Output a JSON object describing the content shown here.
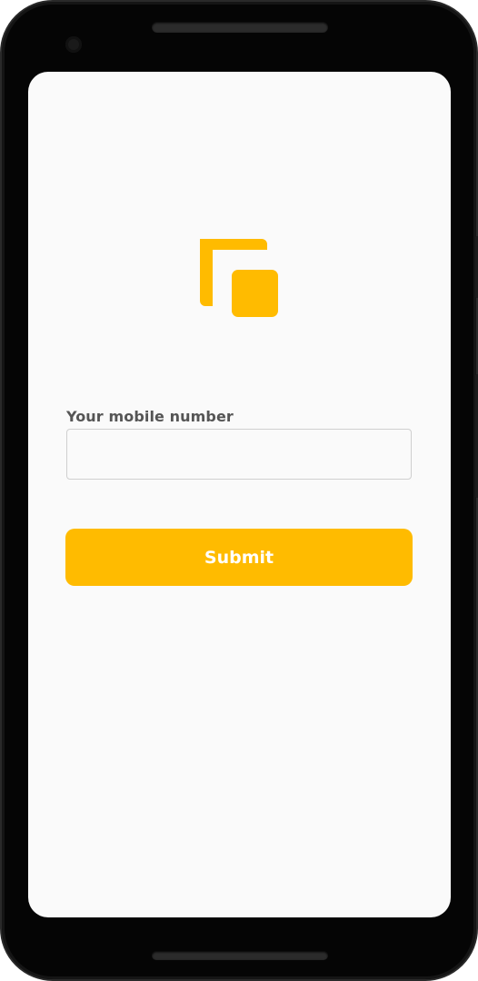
{
  "form": {
    "mobile_label": "Your mobile number",
    "mobile_value": "",
    "mobile_placeholder": "",
    "submit_label": "Submit"
  },
  "icons": {
    "logo": "app-logo-icon"
  },
  "colors": {
    "accent": "#FFBB00",
    "screen_background": "#FAFAFA",
    "label_text": "#555555",
    "button_text": "#FFFFFF",
    "device_frame": "#050505"
  }
}
